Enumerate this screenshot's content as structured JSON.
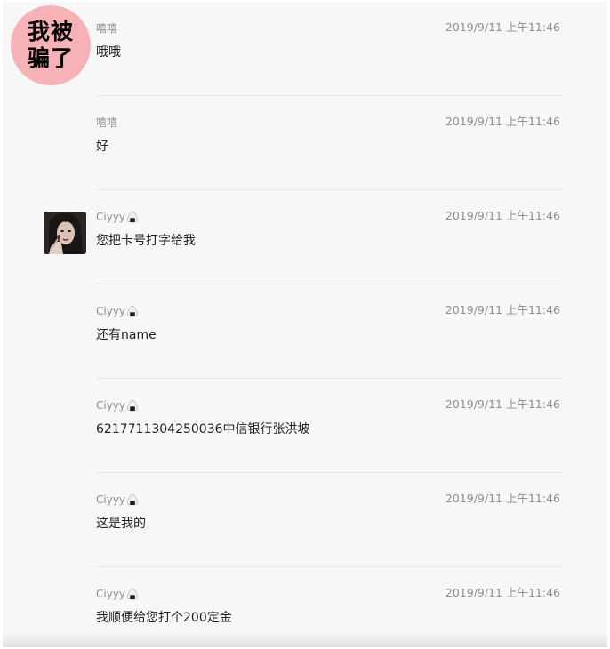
{
  "watermark": {
    "line1": "我被",
    "line2": "骗了",
    "color": "#f6b2b7"
  },
  "messages": [
    {
      "sender": "嘻嘻",
      "has_badge": false,
      "time": "2019/9/11 上午11:46",
      "text": "哦哦"
    },
    {
      "sender": "嘻嘻",
      "has_badge": false,
      "time": "2019/9/11 上午11:46",
      "text": "好"
    },
    {
      "sender": "Ciyyy",
      "has_badge": true,
      "time": "2019/9/11 上午11:46",
      "text": "您把卡号打字给我",
      "has_avatar": true
    },
    {
      "sender": "Ciyyy",
      "has_badge": true,
      "time": "2019/9/11 上午11:46",
      "text": "还有name"
    },
    {
      "sender": "Ciyyy",
      "has_badge": true,
      "time": "2019/9/11 上午11:46",
      "text": "6217711304250036中信银行张洪坡"
    },
    {
      "sender": "Ciyyy",
      "has_badge": true,
      "time": "2019/9/11 上午11:46",
      "text": "这是我的"
    },
    {
      "sender": "Ciyyy",
      "has_badge": true,
      "time": "2019/9/11 上午11:46",
      "text": "我顺便给您打个200定金"
    }
  ],
  "badge_icon": "onigiri-icon",
  "colors": {
    "background": "#f7f7f7",
    "sender": "#8f8f8f",
    "text": "#1f1f1f",
    "divider": "#e6e6e6"
  }
}
